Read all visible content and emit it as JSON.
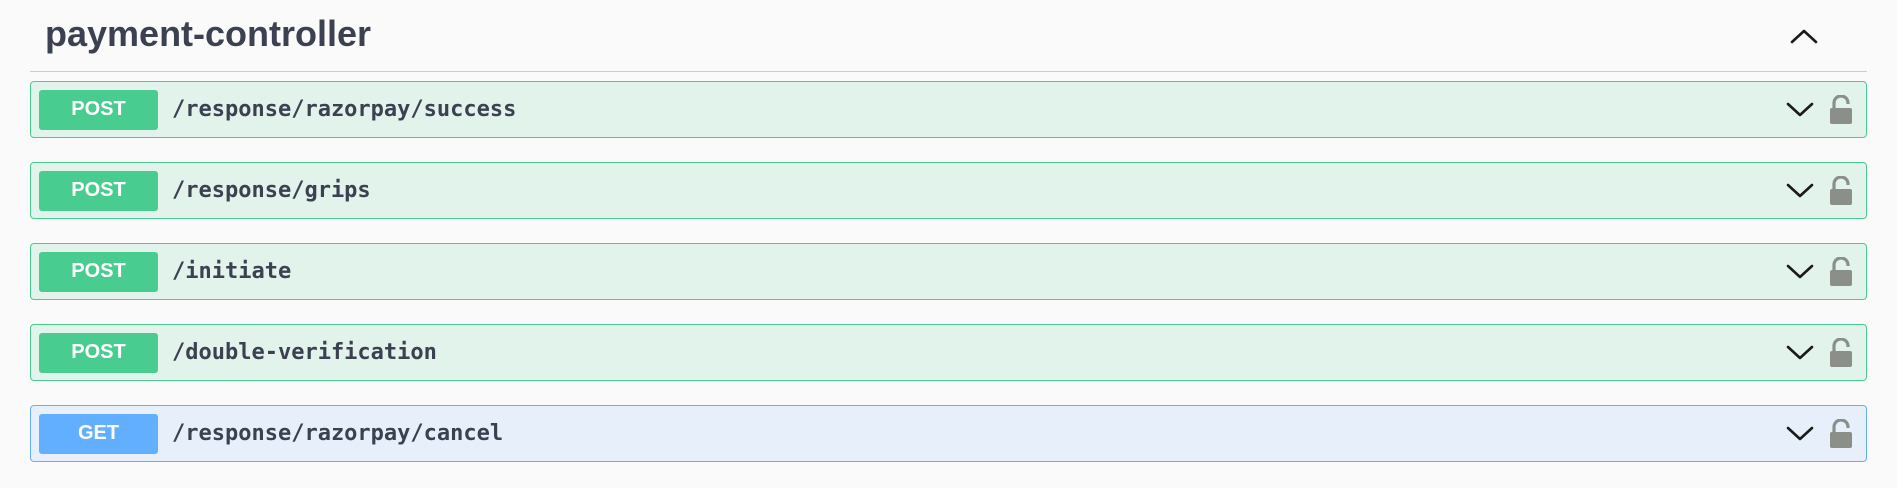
{
  "section": {
    "title": "payment-controller",
    "collapse_icon": "chevron-up-icon"
  },
  "operations": [
    {
      "method": "POST",
      "path": "/response/razorpay/success",
      "expand_icon": "chevron-down-icon",
      "auth_icon": "lock-icon"
    },
    {
      "method": "POST",
      "path": "/response/grips",
      "expand_icon": "chevron-down-icon",
      "auth_icon": "lock-icon"
    },
    {
      "method": "POST",
      "path": "/initiate",
      "expand_icon": "chevron-down-icon",
      "auth_icon": "lock-icon"
    },
    {
      "method": "POST",
      "path": "/double-verification",
      "expand_icon": "chevron-down-icon",
      "auth_icon": "lock-icon"
    },
    {
      "method": "GET",
      "path": "/response/razorpay/cancel",
      "expand_icon": "chevron-down-icon",
      "auth_icon": "lock-icon"
    }
  ],
  "colors": {
    "post": "#49cc90",
    "get": "#61affe",
    "text": "#3b4151",
    "lock": "#8b8f8a"
  }
}
